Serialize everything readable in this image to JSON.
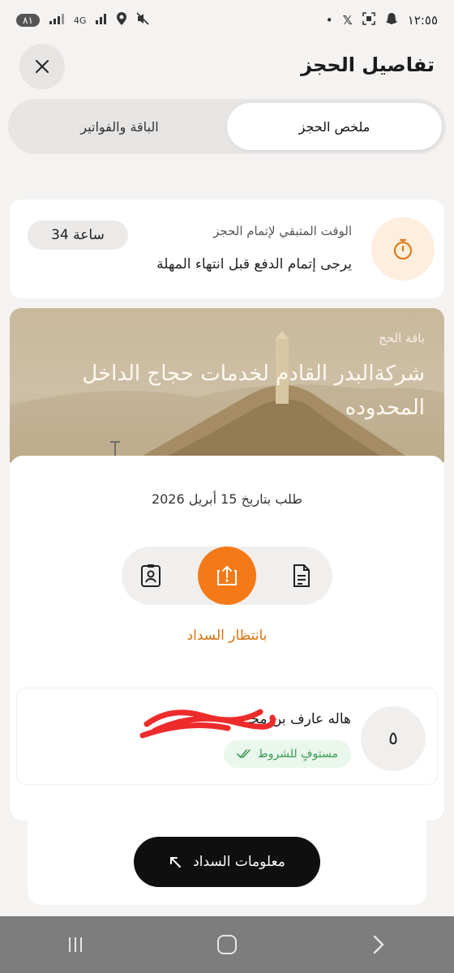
{
  "status_bar": {
    "time": "١٢:٥٥",
    "battery": "٨١",
    "network": "4G"
  },
  "header": {
    "title": "تفاصيل الحجز",
    "close_icon": "close-icon"
  },
  "tabs": [
    {
      "label": "ملخص الحجز",
      "active": true
    },
    {
      "label": "الباقة والفواتير",
      "active": false
    }
  ],
  "timer_card": {
    "title": "الوقت المتبقي لإتمام الحجز",
    "subtitle": "يرجى إتمام الدفع قبل انتهاء المهلة",
    "hours_left": "34 ساعة",
    "icon": "stopwatch-icon"
  },
  "package": {
    "label": "باقة الحج",
    "title": "شركةالبدر القادم لخدمات حجاج الداخل المحدوده"
  },
  "booking": {
    "request_date": "طلب بتاريخ 15 أبريل 2026",
    "steps": [
      {
        "icon": "document-icon",
        "active": false
      },
      {
        "icon": "upload-icon",
        "active": true
      },
      {
        "icon": "id-badge-icon",
        "active": false
      }
    ],
    "status": "بانتظار السداد",
    "accent_color": "#f57a17"
  },
  "traveler": {
    "number": "٥",
    "name": "هاله عارف بن محـ",
    "eligibility": "مستوفٍ للشروط"
  },
  "payment_button": {
    "label": "معلومات السداد",
    "icon": "arrow-up-left-icon"
  },
  "nav": [
    "recent-apps-icon",
    "home-icon",
    "back-icon"
  ]
}
